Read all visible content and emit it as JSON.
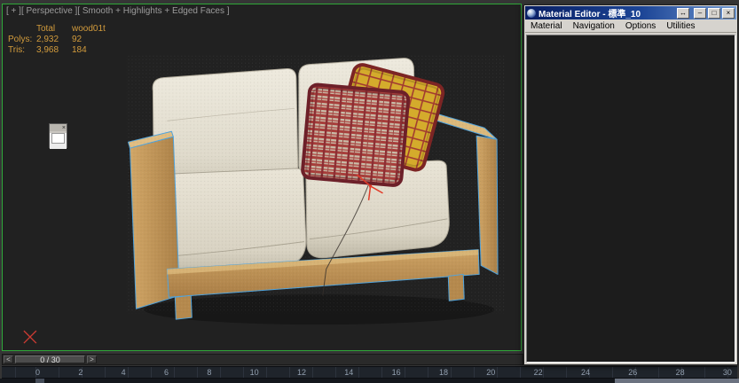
{
  "viewport": {
    "label": "[ + ][ Perspective ][ Smooth + Highlights + Edged Faces ]",
    "stats": {
      "header_total": "Total",
      "header_material": "wood01t",
      "polys_label": "Polys:",
      "polys_total": "2,932",
      "polys_selected": "92",
      "tris_label": "Tris:",
      "tris_total": "3,968",
      "tris_selected": "184"
    }
  },
  "mini_dialog": {
    "close_label": "×"
  },
  "time_slider": {
    "prev_label": "<",
    "next_label": ">",
    "frame_display": "0 / 30"
  },
  "track_bar": {
    "ticks": [
      "0",
      "2",
      "4",
      "6",
      "8",
      "10",
      "12",
      "14",
      "16",
      "18",
      "20",
      "22",
      "24",
      "26",
      "28",
      "30"
    ]
  },
  "material_editor": {
    "title": "Material Editor - 標準_10",
    "menus": [
      "Material",
      "Navigation",
      "Options",
      "Utilities"
    ],
    "buttons": {
      "float_label": "↔",
      "minimize_label": "–",
      "maximize_label": "□",
      "close_label": "×"
    }
  },
  "colors": {
    "viewport_border_green": "#2fa839",
    "stats_text_orange": "#d29b3c",
    "wood": "#c49a60",
    "cushion": "#e6e1d4",
    "pillow_red": "#a83d3a",
    "pillow_yellow": "#d4ab2c",
    "selection_edge_blue": "#4fa3dd",
    "titlebar_blue": "#0a246a"
  }
}
